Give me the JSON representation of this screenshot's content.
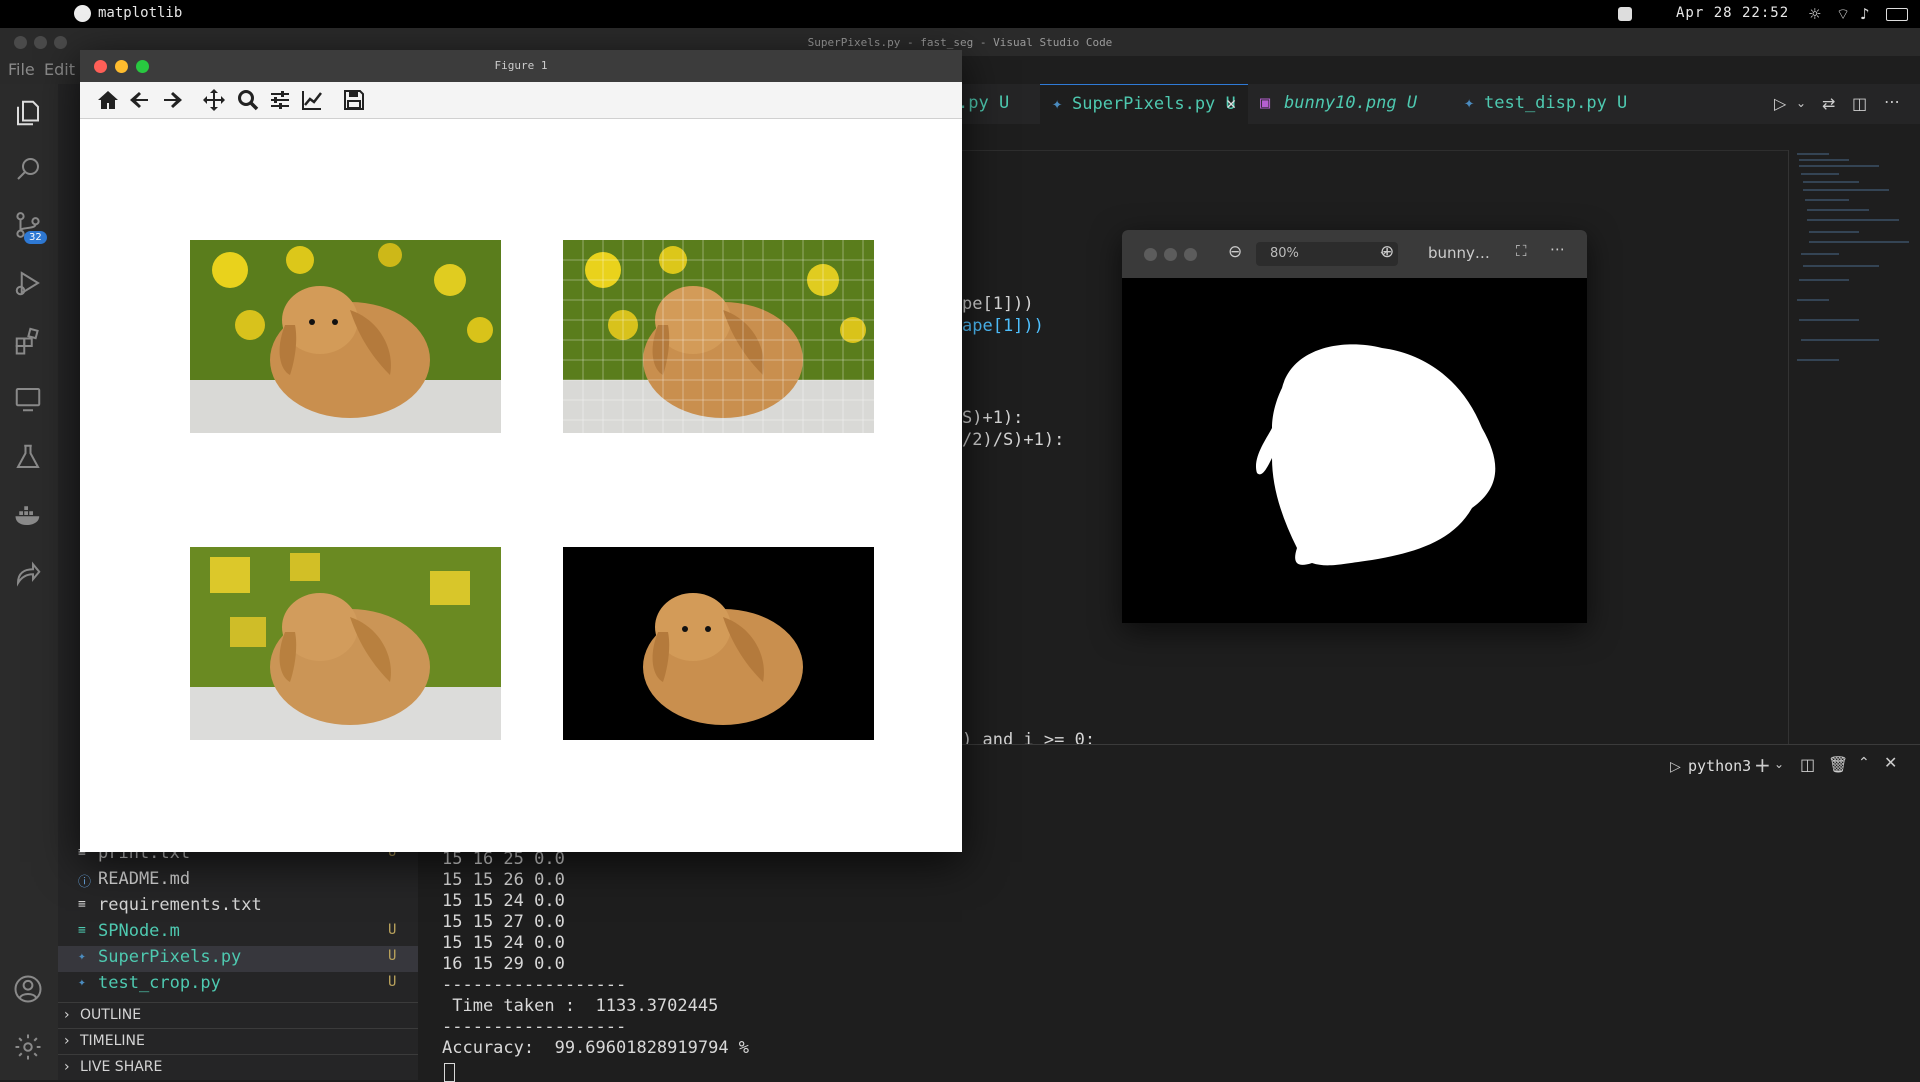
{
  "menubar": {
    "app_name": "matplotlib",
    "clock": "Apr 28 22:52"
  },
  "vscode": {
    "window_title": "SuperPixels.py - fast_seg - Visual Studio Code",
    "menu": [
      "File",
      "Edit"
    ],
    "source_control_badge": "32",
    "tabs": [
      {
        "label": ".py U"
      },
      {
        "label": "SuperPixels.py U",
        "active": true
      },
      {
        "label": "bunny10.png U"
      },
      {
        "label": "test_disp.py U"
      }
    ],
    "code_fragments": [
      "pe[1]))",
      "ape[1]))",
      "S)+1):",
      "/2)/S)+1):",
      ") and i >= 0:"
    ],
    "files": [
      {
        "name": "print.txt",
        "status": "U",
        "icon": "≡"
      },
      {
        "name": "README.md",
        "status": "",
        "icon": "ⓘ"
      },
      {
        "name": "requirements.txt",
        "status": "",
        "icon": "≡"
      },
      {
        "name": "SPNode.m",
        "status": "U",
        "icon": "≡"
      },
      {
        "name": "SuperPixels.py",
        "status": "U",
        "icon": "✦"
      },
      {
        "name": "test_crop.py",
        "status": "U",
        "icon": "✦"
      }
    ],
    "sections": [
      "OUTLINE",
      "TIMELINE",
      "LIVE SHARE"
    ],
    "terminal": {
      "shell": "python3",
      "lines": [
        "15 16 25 0.0",
        "15 15 26 0.0",
        "15 15 24 0.0",
        "15 15 27 0.0",
        "15 15 24 0.0",
        "16 15 29 0.0",
        "------------------",
        " Time taken :  1133.3702445",
        "------------------",
        "Accuracy:  99.69601828919794 %"
      ]
    }
  },
  "viewer": {
    "zoom": "80%",
    "filename": "bunny…"
  },
  "figure": {
    "title": "Figure 1",
    "toolbar": [
      "home-icon",
      "back-icon",
      "forward-icon",
      "pan-icon",
      "zoom-icon",
      "configure-icon",
      "edit-curves-icon",
      "save-icon"
    ]
  },
  "colors": {
    "accent_blue": "#2f7ad6",
    "untracked": "#b9a25c",
    "tab_active": "#4ec9b0"
  }
}
